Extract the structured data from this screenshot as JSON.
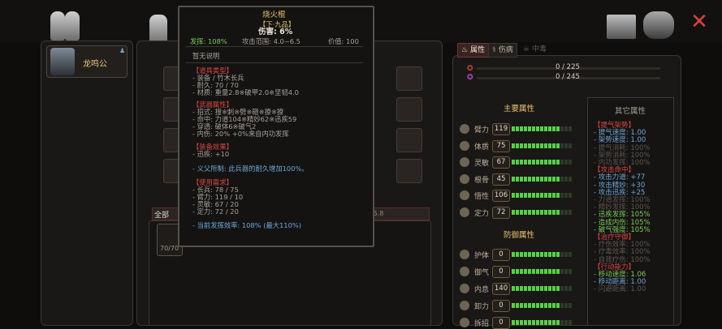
{
  "top": {
    "close_glyph": "✕"
  },
  "character": {
    "name": "龙鸣公"
  },
  "inventory": {
    "filter_all": "全部",
    "weight": "1.0 / 35.8",
    "item_durability": "70/70",
    "unknown": "?"
  },
  "tooltip": {
    "name": "烧火棍",
    "grade": "【下·九品】",
    "damage": "伤害: 6%",
    "stats_line": {
      "penetrate": "发挥: 108%",
      "range": "攻击范围: 4.0~6.5",
      "value": "价值: 100"
    },
    "no_desc": "暂无说明",
    "item_type_title": "【道具类型】",
    "item_type_lines": [
      "- 装备 / 竹木长兵",
      "- 耐久: 70 / 70",
      "- 材质: 重量2.8※破甲2.0※坚韧4.0"
    ],
    "weapon_title": "【武器属性】",
    "weapon_lines": [
      "- 招式: 搜※刺※劈※砸※撩※撩",
      "- 命中: 力道104※精妙62※迅疾59",
      "- 穿透: 破体6※破气2",
      "- 内伤: 20% +0%来自内功发挥"
    ],
    "equip_effect_title": "【装备效果】",
    "equip_effect_lines": [
      "- 迅疾: +10"
    ],
    "special": "- 义父所制: 此兵器的耐久增加100%。",
    "requirement_title": "【使用需求】",
    "requirement_lines": [
      "- 长兵: 78 / 75",
      "- 臂力: 119 / 10",
      "- 灵敏: 67 / 20",
      "- 定力: 72 / 20"
    ],
    "efficiency": "- 当前发挥效率: 108% (最大110%)"
  },
  "tabs": {
    "attr": "属性",
    "injury": "伤病",
    "poison": "中毒"
  },
  "bars": {
    "hp": "0 / 225",
    "qi": "0 / 245"
  },
  "main_attrs": {
    "title": "主要属性",
    "rows": [
      {
        "label": "臂力",
        "value": "119",
        "level": 0.8
      },
      {
        "label": "体质",
        "value": "75",
        "level": 0.8
      },
      {
        "label": "灵敏",
        "value": "67",
        "level": 0.8
      },
      {
        "label": "根骨",
        "value": "45",
        "level": 0.8
      },
      {
        "label": "悟性",
        "value": "106",
        "level": 0.8
      },
      {
        "label": "定力",
        "value": "72",
        "level": 0.8
      }
    ]
  },
  "defense_attrs": {
    "title": "防御属性",
    "rows": [
      {
        "label": "护体",
        "value": "0",
        "level": 0.8
      },
      {
        "label": "御气",
        "value": "0",
        "level": 0.8
      },
      {
        "label": "内息",
        "value": "140",
        "level": 0.8
      },
      {
        "label": "卸力",
        "value": "0",
        "level": 0.8
      },
      {
        "label": "拆招",
        "value": "0",
        "level": 0.8
      }
    ]
  },
  "other_attrs": {
    "title": "其它属性",
    "lines": [
      {
        "text": "【提气架势】",
        "cls": "red"
      },
      {
        "text": "- 提气速度: 1.00",
        "cls": "blue"
      },
      {
        "text": "- 架势速度: 1.00",
        "cls": "blue"
      },
      {
        "text": "- 提气消耗: 100%",
        "cls": "dim"
      },
      {
        "text": "- 架势消耗: 100%",
        "cls": "dim"
      },
      {
        "text": "- 内功发挥: 100%",
        "cls": "dim"
      },
      {
        "text": "【攻击命中】",
        "cls": "red"
      },
      {
        "text": "- 攻击力道: +77",
        "cls": "blue"
      },
      {
        "text": "- 攻击精妙: +30",
        "cls": "blue"
      },
      {
        "text": "- 攻击迅疾: +25",
        "cls": "blue"
      },
      {
        "text": "- 力道发挥: 100%",
        "cls": "dim"
      },
      {
        "text": "- 精妙发挥: 100%",
        "cls": "dim"
      },
      {
        "text": "- 迅疾发挥: 105%",
        "cls": "green"
      },
      {
        "text": "- 造成内伤: 105%",
        "cls": "green"
      },
      {
        "text": "- 破气强度: 105%",
        "cls": "green"
      },
      {
        "text": "【治疗守御】",
        "cls": "red"
      },
      {
        "text": "- 疗伤效率: 100%",
        "cls": "dim"
      },
      {
        "text": "- 疗毒效率: 100%",
        "cls": "dim"
      },
      {
        "text": "- 自我疗伤: 100%",
        "cls": "dim"
      },
      {
        "text": "【行动能力】",
        "cls": "red"
      },
      {
        "text": "- 移动速度: 1.06",
        "cls": "green"
      },
      {
        "text": "- 移动距离: 1.00",
        "cls": "blue"
      },
      {
        "text": "- 闪避距离: 1.00",
        "cls": "dim"
      }
    ]
  }
}
